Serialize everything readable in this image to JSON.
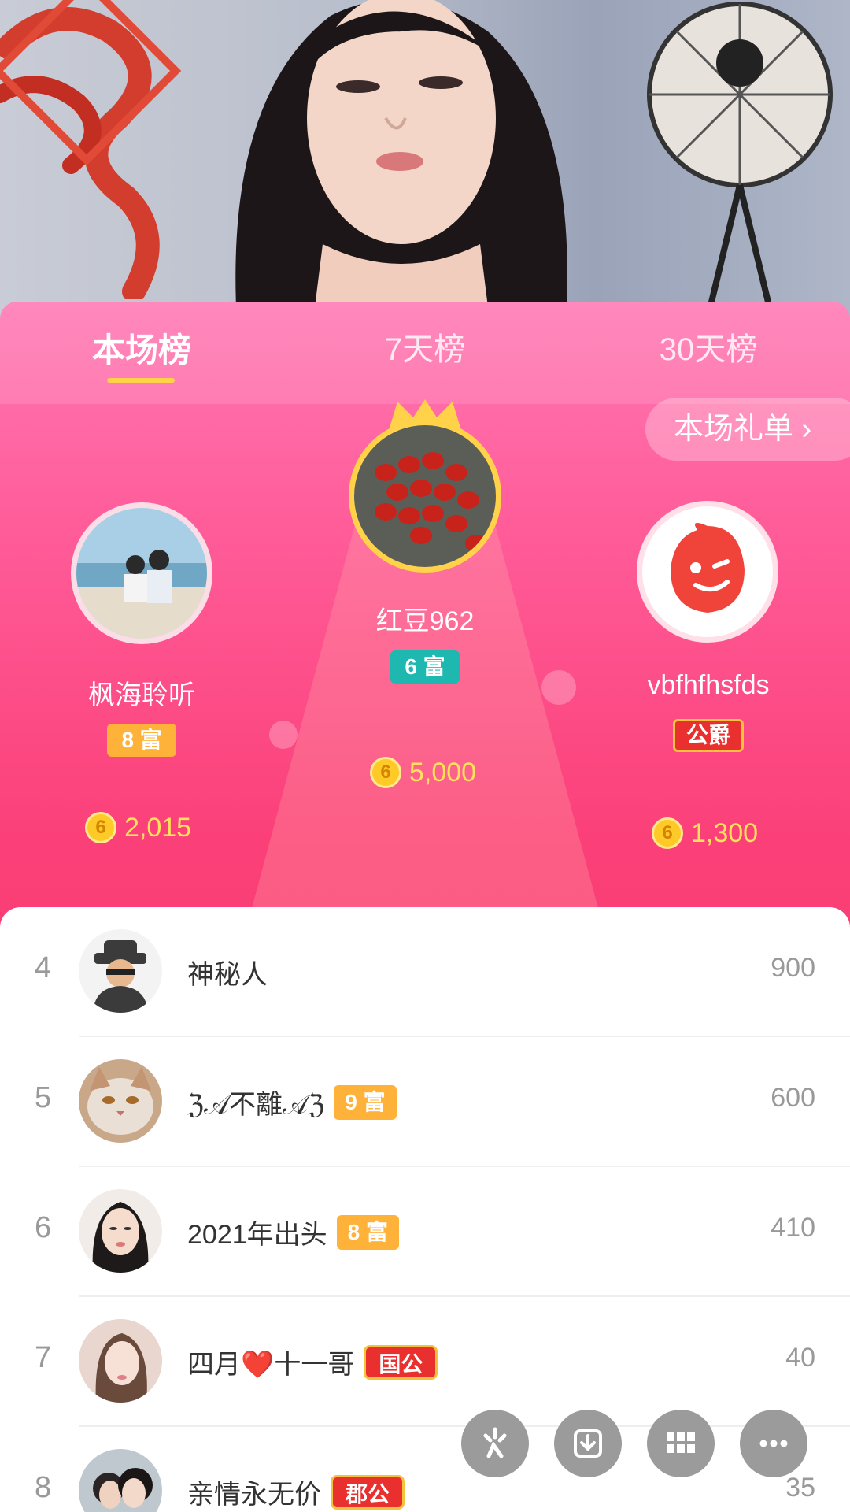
{
  "tabs": [
    {
      "label": "本场榜",
      "active": true
    },
    {
      "label": "7天榜",
      "active": false
    },
    {
      "label": "30天榜",
      "active": false
    }
  ],
  "gift_list_button": "本场礼单 ›",
  "podium": {
    "first": {
      "name": "红豆962",
      "badge": "6 富",
      "coins": "5,000",
      "rank": "1"
    },
    "second": {
      "name": "枫海聆听",
      "badge": "8 富",
      "coins": "2,015",
      "rank": "2"
    },
    "third": {
      "name": "vbfhfhsfds",
      "badge": "公爵",
      "coins": "1,300",
      "rank": "3"
    }
  },
  "coin_symbol": "6",
  "list": [
    {
      "rank": "4",
      "name": "神秘人",
      "badge": "",
      "score": "900"
    },
    {
      "rank": "5",
      "name": "ℨ𝒜不離𝒜ℨ",
      "badge": "9 富",
      "score": "600"
    },
    {
      "rank": "6",
      "name": "2021年出头",
      "badge": "8 富",
      "score": "410"
    },
    {
      "rank": "7",
      "name": "四月❤️十一哥",
      "badge": "国公",
      "score": "40"
    },
    {
      "rank": "8",
      "name": "亲情永无价",
      "badge": "郡公",
      "score": "35"
    }
  ],
  "colors": {
    "accent": "#fb3f78",
    "gold": "#ffd24a",
    "level_badge": "#ffb23a",
    "teal_badge": "#1fb8b0"
  }
}
